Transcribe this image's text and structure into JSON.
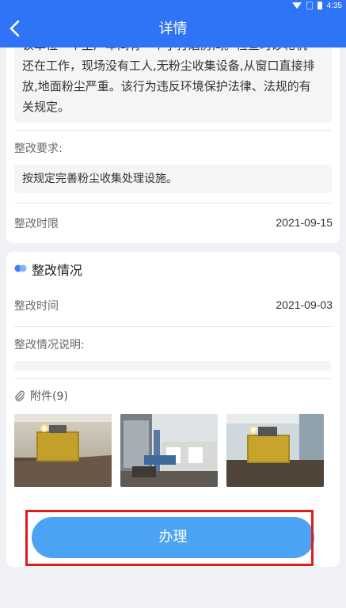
{
  "status_bar": {
    "time": "4:35"
  },
  "header": {
    "title": "详情"
  },
  "problem": {
    "description_lines": [
      "该单位一个生产车间有一个小打磨房间。检查时砂轮机",
      "还在工作，现场没有工人,无粉尘收集设备,从窗口直接排",
      "放,地面粉尘严重。该行为违反环境保护法律、法规的有",
      "关规定。"
    ],
    "requirement_label": "整改要求:",
    "requirement_text": "按规定完善粉尘收集处理设施。",
    "deadline_label": "整改时限",
    "deadline_value": "2021-09-15"
  },
  "rectification": {
    "section_title": "整改情况",
    "time_label": "整改时间",
    "time_value": "2021-09-03",
    "explain_label": "整改情况说明:",
    "attachments_label": "附件(9)"
  },
  "colors": {
    "primary": "#2f74f6",
    "button": "#4da3f3",
    "highlight": "#e11b1b"
  },
  "actions": {
    "submit_label": "办理"
  }
}
